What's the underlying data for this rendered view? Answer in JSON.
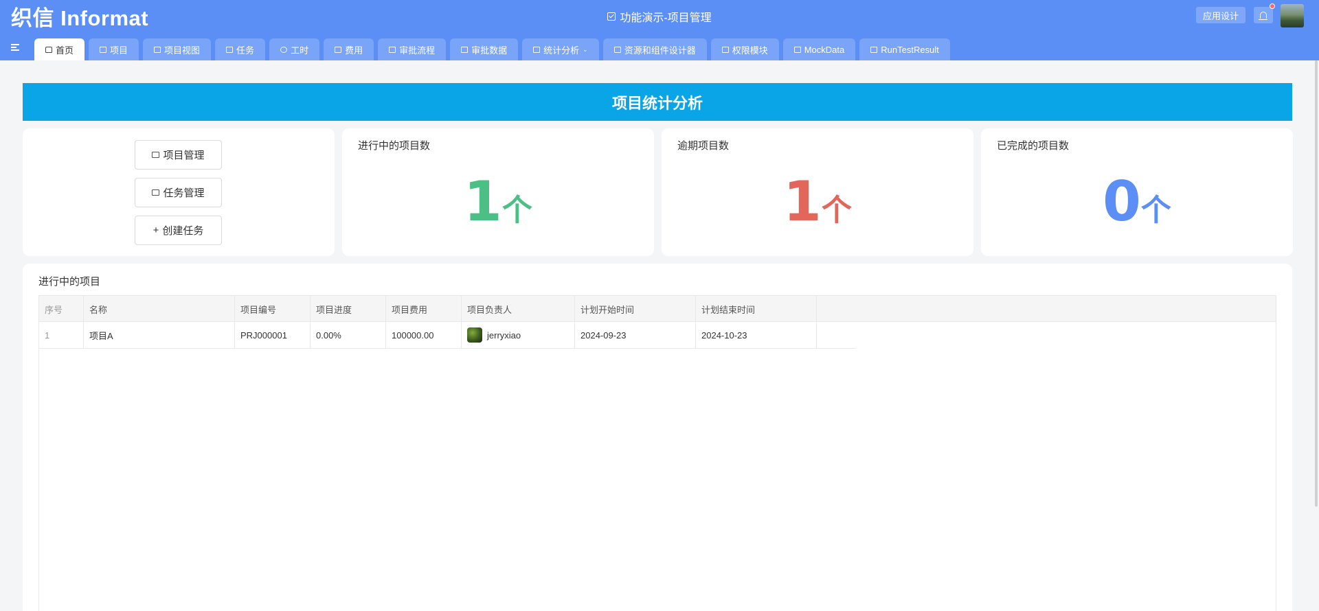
{
  "header": {
    "logo": "织信 Informat",
    "app_title": "功能演示-项目管理",
    "design_button": "应用设计"
  },
  "tabs": [
    {
      "label": "首页",
      "icon": "home-icon",
      "active": true
    },
    {
      "label": "项目",
      "icon": "project-icon"
    },
    {
      "label": "项目视图",
      "icon": "table-icon"
    },
    {
      "label": "任务",
      "icon": "list-icon"
    },
    {
      "label": "工时",
      "icon": "clock-icon"
    },
    {
      "label": "费用",
      "icon": "money-icon"
    },
    {
      "label": "审批流程",
      "icon": "flow-icon"
    },
    {
      "label": "审批数据",
      "icon": "flow-icon"
    },
    {
      "label": "统计分析",
      "icon": "chart-icon",
      "dropdown": true
    },
    {
      "label": "资源和组件设计器",
      "icon": "component-icon"
    },
    {
      "label": "权限模块",
      "icon": "grid-icon"
    },
    {
      "label": "MockData",
      "icon": "grid-icon"
    },
    {
      "label": "RunTestResult",
      "icon": "grid-icon"
    }
  ],
  "banner": {
    "title": "项目统计分析"
  },
  "actions": [
    {
      "label": "项目管理",
      "icon": "project-icon"
    },
    {
      "label": "任务管理",
      "icon": "list-icon"
    },
    {
      "label": "创建任务",
      "icon": "plus-icon"
    }
  ],
  "stats": [
    {
      "label": "进行中的项目数",
      "value": "1",
      "unit": "个",
      "color": "#4cbf84"
    },
    {
      "label": "逾期项目数",
      "value": "1",
      "unit": "个",
      "color": "#e3665a"
    },
    {
      "label": "已完成的项目数",
      "value": "0",
      "unit": "个",
      "color": "#5b8ff5"
    }
  ],
  "table": {
    "title": "进行中的项目",
    "columns": [
      "序号",
      "名称",
      "项目编号",
      "项目进度",
      "项目费用",
      "项目负责人",
      "计划开始时间",
      "计划结束时间"
    ],
    "rows": [
      [
        "1",
        "项目A",
        "PRJ000001",
        "0.00%",
        "100000.00",
        "jerryxiao",
        "2024-09-23",
        "2024-10-23"
      ]
    ]
  },
  "colors": {
    "header": "#5b8ff5",
    "banner": "#0aa5e6"
  }
}
